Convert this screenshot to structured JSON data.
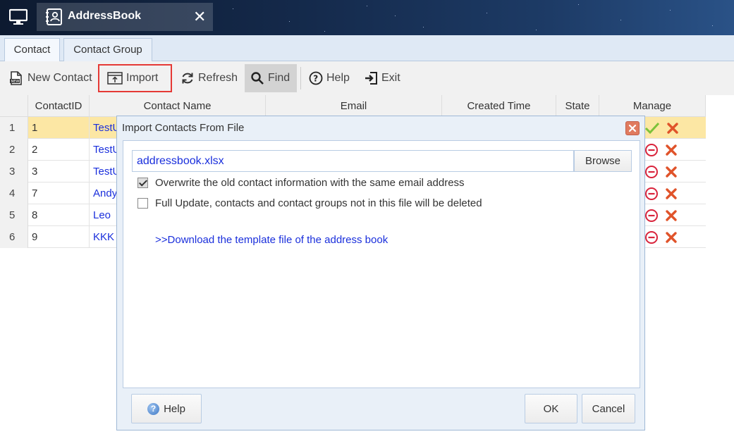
{
  "window": {
    "app_title": "AddressBook"
  },
  "tabs": [
    {
      "label": "Contact"
    },
    {
      "label": "Contact Group"
    }
  ],
  "toolbar": {
    "new_contact": "New Contact",
    "import": "Import",
    "refresh": "Refresh",
    "find": "Find",
    "help": "Help",
    "exit": "Exit"
  },
  "grid": {
    "columns": [
      "ContactID",
      "Contact Name",
      "Email",
      "Created Time",
      "State",
      "Manage"
    ],
    "rows": [
      {
        "row_no": "1",
        "contact_id": "1",
        "name": "TestU",
        "selected": true
      },
      {
        "row_no": "2",
        "contact_id": "2",
        "name": "TestU"
      },
      {
        "row_no": "3",
        "contact_id": "3",
        "name": "TestU"
      },
      {
        "row_no": "4",
        "contact_id": "7",
        "name": "Andy"
      },
      {
        "row_no": "5",
        "contact_id": "8",
        "name": "Leo"
      },
      {
        "row_no": "6",
        "contact_id": "9",
        "name": "KKK"
      }
    ]
  },
  "dialog": {
    "title": "Import Contacts From File",
    "file_value": "addressbook.xlsx",
    "browse": "Browse",
    "option_overwrite": "Overwrite the old contact information with the same email address",
    "option_overwrite_checked": true,
    "option_full_update": "Full Update, contacts and contact groups not in this file will be deleted",
    "option_full_update_checked": false,
    "download_link": ">>Download the template file of the address book",
    "help": "Help",
    "ok": "OK",
    "cancel": "Cancel"
  },
  "colors": {
    "accent_link": "#1a2fdc",
    "selected_row": "#fce7a4",
    "highlight_border": "#e53935"
  }
}
